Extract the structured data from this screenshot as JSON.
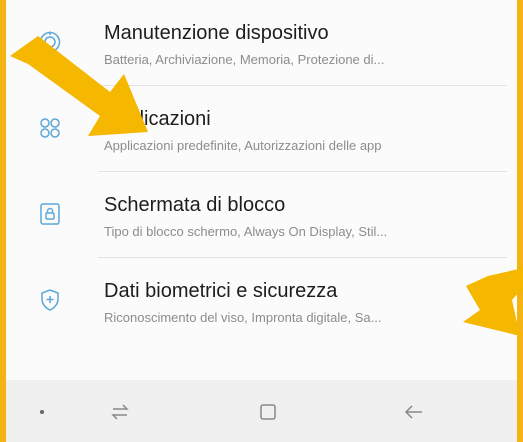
{
  "settings": {
    "items": [
      {
        "icon": "device-care-icon",
        "title": "Manutenzione dispositivo",
        "subtitle": "Batteria, Archiviazione, Memoria, Protezione di..."
      },
      {
        "icon": "apps-icon",
        "title": "Applicazioni",
        "subtitle": "Applicazioni predefinite, Autorizzazioni delle app"
      },
      {
        "icon": "lock-screen-icon",
        "title": "Schermata di blocco",
        "subtitle": "Tipo di blocco schermo, Always On Display, Stil..."
      },
      {
        "icon": "biometrics-security-icon",
        "title": "Dati biometrici e sicurezza",
        "subtitle": "Riconoscimento del viso, Impronta digitale, Sa..."
      }
    ]
  },
  "colors": {
    "background_frame": "#f3b414",
    "arrow": "#f5b700",
    "icon_blue": "#5aa7d8",
    "title_text": "#1d1d1d",
    "subtitle_text": "#8c8c8c"
  },
  "navbar": {
    "buttons": [
      "dot-icon",
      "recent-apps-icon",
      "home-icon",
      "back-icon"
    ]
  }
}
